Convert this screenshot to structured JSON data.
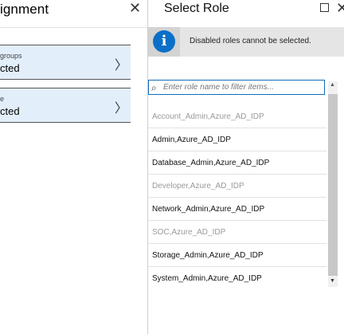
{
  "left_blade": {
    "title": "ignment",
    "cards": [
      {
        "sub": "groups",
        "main": "cted"
      },
      {
        "sub": "e",
        "main": "cted"
      }
    ]
  },
  "right_blade": {
    "title": "Select Role",
    "info_message": "Disabled roles cannot be selected.",
    "filter": {
      "placeholder": "Enter role name to filter items...",
      "value": ""
    },
    "roles": [
      {
        "label": "Account_Admin,Azure_AD_IDP",
        "enabled": false
      },
      {
        "label": "Admin,Azure_AD_IDP",
        "enabled": true
      },
      {
        "label": "Database_Admin,Azure_AD_IDP",
        "enabled": true
      },
      {
        "label": "Developer,Azure_AD_IDP",
        "enabled": false
      },
      {
        "label": "Network_Admin,Azure_AD_IDP",
        "enabled": true
      },
      {
        "label": "SOC,Azure_AD_IDP",
        "enabled": false
      },
      {
        "label": "Storage_Admin,Azure_AD_IDP",
        "enabled": true
      },
      {
        "label": "System_Admin,Azure_AD_IDP",
        "enabled": true
      }
    ]
  },
  "icons": {
    "left_close": "close-icon",
    "maximize": "maximize-icon",
    "right_close": "close-icon",
    "info": "info-icon",
    "search": "search-icon",
    "chevron": "chevron-right-icon",
    "scroll_up": "scroll-up-arrow-icon",
    "scroll_down": "scroll-down-arrow-icon"
  },
  "colors": {
    "accent": "#0f6cbd",
    "info_blue": "#0a6fc9",
    "selected_card_bg": "#e2effb",
    "banner_bg": "#e5e5e5",
    "disabled_text": "#9a9a9a"
  }
}
